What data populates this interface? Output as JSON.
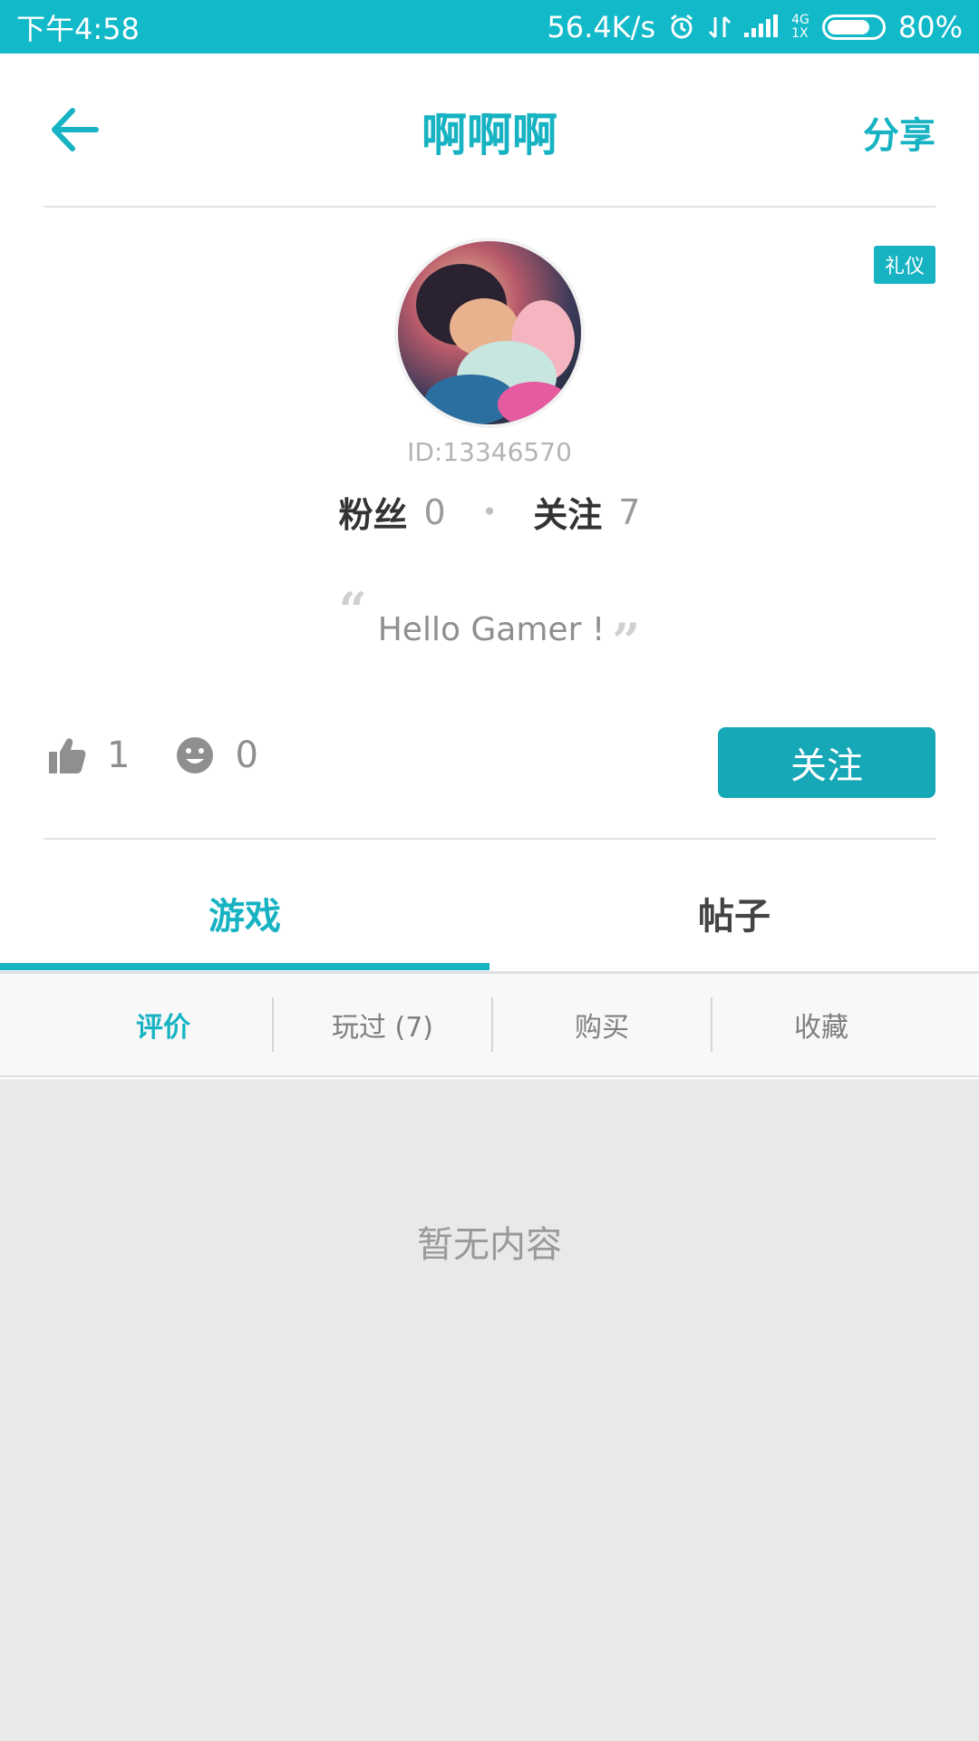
{
  "status_bar": {
    "time": "下午4:58",
    "network_speed": "56.4K/s",
    "net_type_top": "4G",
    "net_type_bottom": "1X",
    "battery": "80%"
  },
  "header": {
    "title": "啊啊啊",
    "share_label": "分享",
    "back_icon": "back-arrow-icon"
  },
  "profile": {
    "badge": "礼仪",
    "user_id": "ID:13346570",
    "fans_label": "粉丝",
    "fans_count": "0",
    "following_label": "关注",
    "following_count": "7",
    "signature": "Hello Gamer !",
    "likes_count": "1",
    "smiles_count": "0",
    "follow_button": "关注"
  },
  "tabs": [
    {
      "label": "游戏",
      "active": true
    },
    {
      "label": "帖子",
      "active": false
    }
  ],
  "sub_tabs": [
    {
      "label": "评价",
      "active": true
    },
    {
      "label": "玩过 (7)",
      "active": false
    },
    {
      "label": "购买",
      "active": false
    },
    {
      "label": "收藏",
      "active": false
    }
  ],
  "content": {
    "empty_text": "暂无内容"
  },
  "colors": {
    "accent": "#17b3c3",
    "status_bar": "#12b9c9"
  }
}
